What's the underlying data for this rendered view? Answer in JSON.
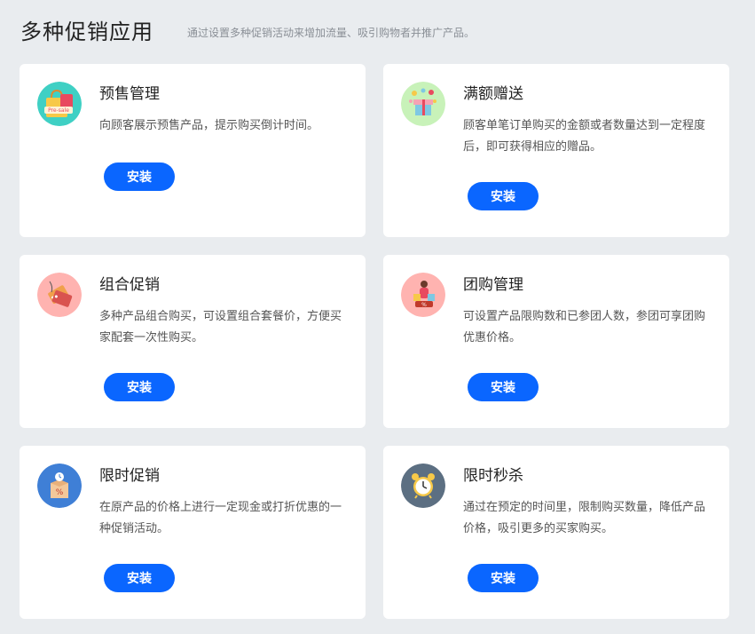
{
  "header": {
    "title": "多种促销应用",
    "subtitle": "通过设置多种促销活动来增加流量、吸引购物者并推广产品。"
  },
  "apps": [
    {
      "title": "预售管理",
      "desc": "向顾客展示预售产品，提示购买倒计时间。",
      "button": "安装",
      "icon": "presale-bag-icon",
      "icon_bg": "#3fd0c4",
      "icon_text": "Pre-sale"
    },
    {
      "title": "满额赠送",
      "desc": "顾客单笔订单购买的金额或者数量达到一定程度后，即可获得相应的赠品。",
      "button": "安装",
      "icon": "gift-box-icon",
      "icon_bg": "#c8f2b9"
    },
    {
      "title": "组合促销",
      "desc": "多种产品组合购买，可设置组合套餐价，方便买家配套一次性购买。",
      "button": "安装",
      "icon": "price-tags-icon",
      "icon_bg": "#ffb3b0"
    },
    {
      "title": "团购管理",
      "desc": "可设置产品限购数和已参团人数，参团可享团购优惠价格。",
      "button": "安装",
      "icon": "group-buy-icon",
      "icon_bg": "#ffb3b0",
      "icon_text": "%"
    },
    {
      "title": "限时促销",
      "desc": "在原产品的价格上进行一定现金或打折优惠的一种促销活动。",
      "button": "安装",
      "icon": "timed-discount-box-icon",
      "icon_bg": "#3f7fd6",
      "icon_text": "%"
    },
    {
      "title": "限时秒杀",
      "desc": "通过在预定的时间里，限制购买数量，降低产品价格，吸引更多的买家购买。",
      "button": "安装",
      "icon": "alarm-clock-icon",
      "icon_bg": "#5c6f82"
    }
  ],
  "colors": {
    "background": "#e9ecef",
    "card": "#ffffff",
    "button": "#0a66ff"
  }
}
